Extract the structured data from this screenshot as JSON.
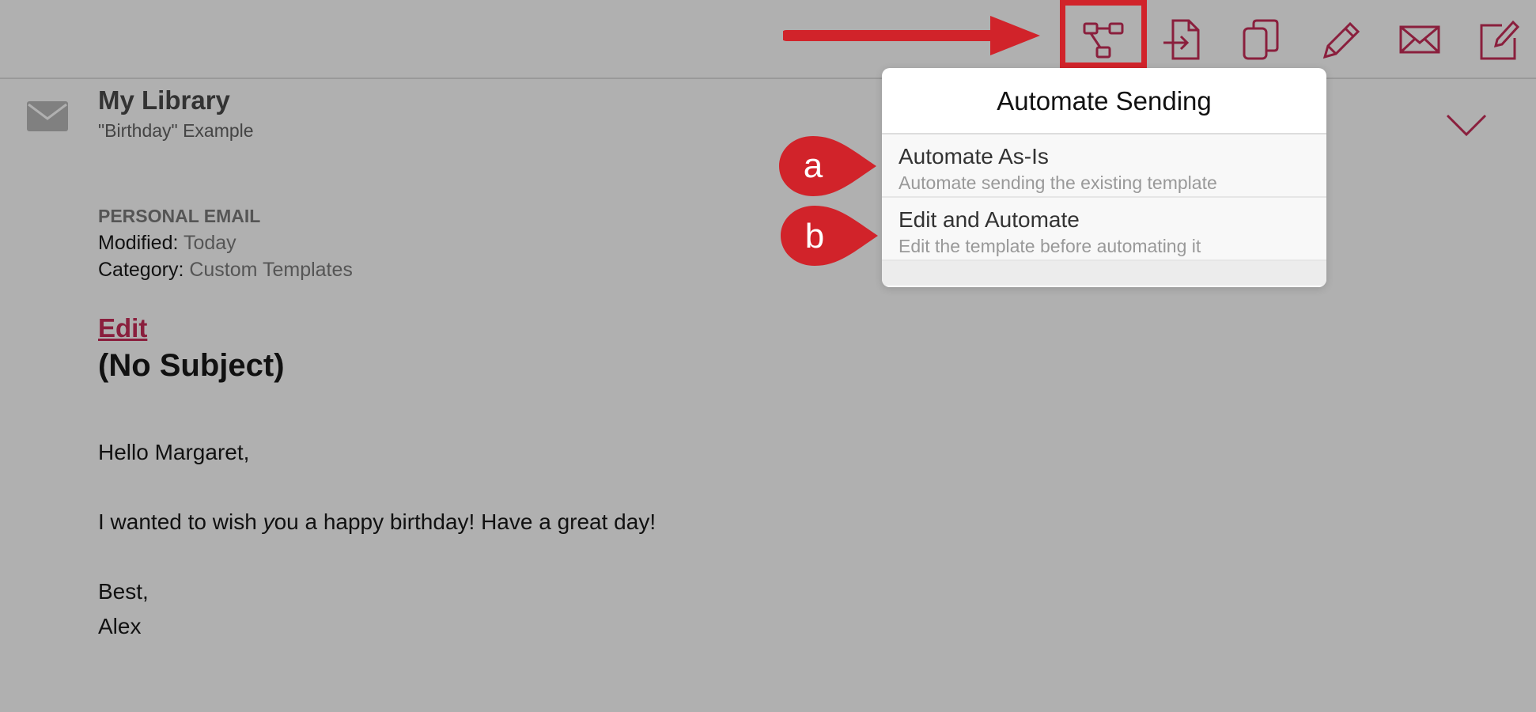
{
  "toolbar": {
    "icons": [
      "workflow-icon",
      "export-document-icon",
      "copy-icon",
      "pencil-icon",
      "envelope-icon",
      "compose-icon"
    ],
    "accent": "#8a1f3d",
    "annotation_color": "#d1232a"
  },
  "header": {
    "title": "My Library",
    "subtitle": "\"Birthday\" Example"
  },
  "meta": {
    "kind": "PERSONAL EMAIL",
    "modified_label": "Modified:",
    "modified_value": "Today",
    "category_label": "Category:",
    "category_value": "Custom Templates"
  },
  "content": {
    "edit_label": "Edit",
    "subject": "(No Subject)",
    "greeting": "Hello Margaret,",
    "message_pre": "I wanted to wish ",
    "message_em": "y",
    "message_post": "ou a happy birthday! Have a great day!",
    "signoff": "Best,",
    "name": "Alex"
  },
  "popover": {
    "title": "Automate Sending",
    "options": [
      {
        "marker": "a",
        "title": "Automate As-Is",
        "description": "Automate sending the existing template"
      },
      {
        "marker": "b",
        "title": "Edit and Automate",
        "description": "Edit the template before automating it"
      }
    ]
  }
}
